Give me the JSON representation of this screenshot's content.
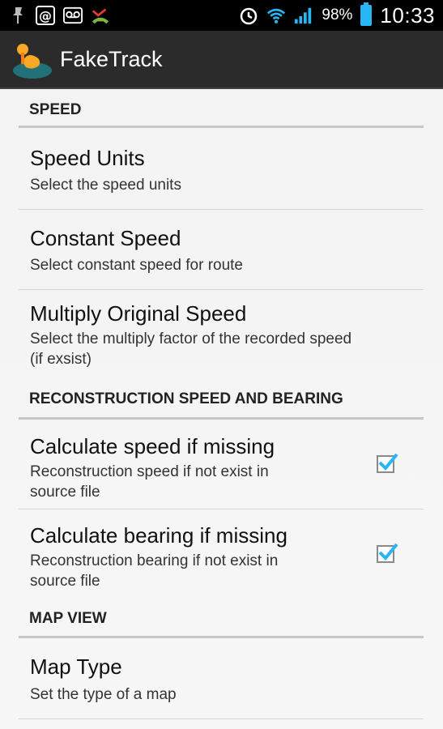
{
  "statusbar": {
    "battery_percent": "98%",
    "time": "10:33",
    "icons": [
      "pin-icon",
      "at-icon",
      "voicemail-icon",
      "missed-call-icon",
      "alarm-icon",
      "wifi-icon",
      "signal-icon",
      "battery-icon"
    ],
    "accent": "#29b6f6"
  },
  "actionbar": {
    "title": "FakeTrack"
  },
  "sections": {
    "speed": "SPEED",
    "reconstruction": "RECONSTRUCTION SPEED AND BEARING",
    "map_view": "MAP VIEW"
  },
  "prefs": {
    "speed_units": {
      "title": "Speed Units",
      "summary": "Select the speed units"
    },
    "constant_speed": {
      "title": "Constant Speed",
      "summary": "Select constant speed for route"
    },
    "multiply_speed": {
      "title": "Multiply Original Speed",
      "summary_line1": "Select the multiply factor of the recorded speed",
      "summary_line2": "(if exsist)"
    },
    "calc_speed": {
      "title": "Calculate speed if missing",
      "summary_line1": "Reconstruction speed if not exist in",
      "summary_line2": "source file",
      "checked": true
    },
    "calc_bearing": {
      "title": "Calculate bearing if missing",
      "summary_line1": "Reconstruction bearing if not exist in",
      "summary_line2": "source file",
      "checked": true
    },
    "map_type": {
      "title": "Map Type",
      "summary": "Set the type of a map"
    }
  }
}
